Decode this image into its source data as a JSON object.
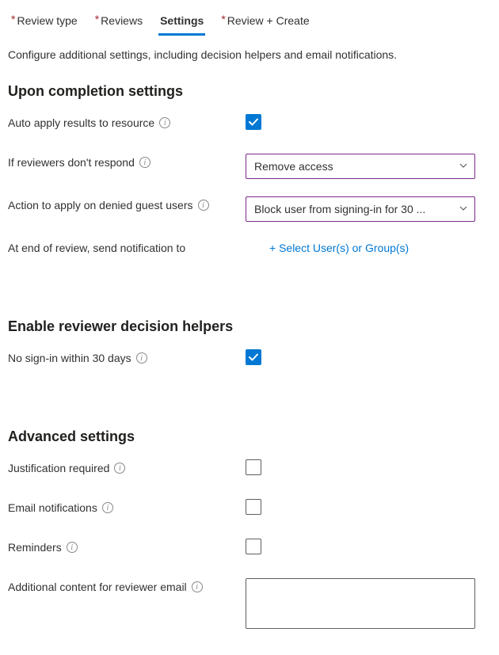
{
  "tabs": {
    "review_type": "Review type",
    "reviews": "Reviews",
    "settings": "Settings",
    "review_create": "Review + Create"
  },
  "description": "Configure additional settings, including decision helpers and email notifications.",
  "sections": {
    "completion": {
      "title": "Upon completion settings",
      "auto_apply_label": "Auto apply results to resource",
      "auto_apply_checked": true,
      "no_respond_label": "If reviewers don't respond",
      "no_respond_value": "Remove access",
      "denied_guests_label": "Action to apply on denied guest users",
      "denied_guests_value": "Block user from signing-in for 30 ...",
      "notify_label": "At end of review, send notification to",
      "notify_link": "+ Select User(s) or Group(s)"
    },
    "helpers": {
      "title": "Enable reviewer decision helpers",
      "no_signin_label": "No sign-in within 30 days",
      "no_signin_checked": true
    },
    "advanced": {
      "title": "Advanced settings",
      "justification_label": "Justification required",
      "justification_checked": false,
      "email_label": "Email notifications",
      "email_checked": false,
      "reminders_label": "Reminders",
      "reminders_checked": false,
      "additional_label": "Additional content for reviewer email",
      "additional_value": ""
    }
  }
}
